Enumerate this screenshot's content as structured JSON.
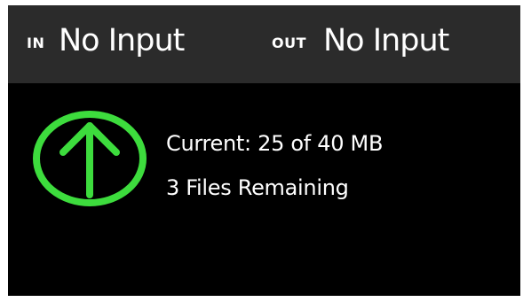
{
  "header": {
    "in_label": "IN",
    "in_value": "No Input",
    "out_label": "OUT",
    "out_value": "No Input"
  },
  "status": {
    "icon": "upload-arrow-icon",
    "accent_color": "#3ddc3d",
    "current_line": "Current: 25 of 40 MB",
    "remaining_line": "3 Files Remaining"
  },
  "colors": {
    "topbar": "#2b2b2b",
    "background": "#000000",
    "text": "#ffffff"
  }
}
